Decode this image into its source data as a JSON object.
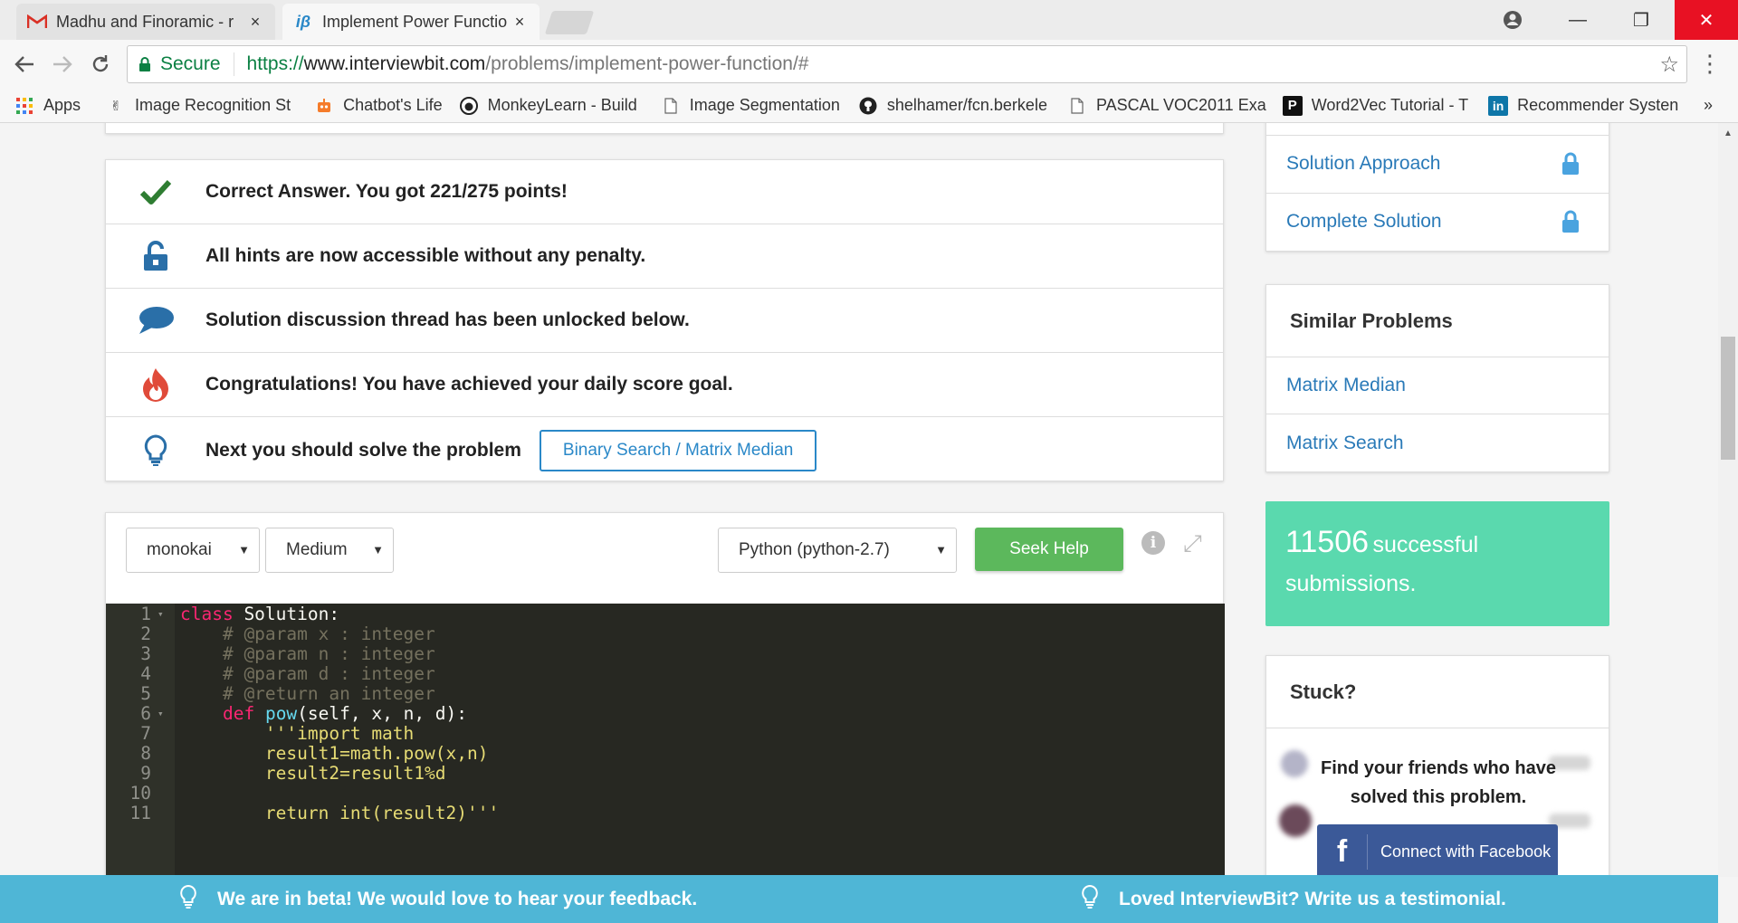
{
  "browser": {
    "tabs": [
      {
        "title": "Madhu and Finoramic - r",
        "favicon": "gmail-icon",
        "active": false
      },
      {
        "title": "Implement Power Functio",
        "favicon": "interviewbit-icon",
        "active": true
      }
    ],
    "close_glyph": "×",
    "window_controls": {
      "minimize": "—",
      "restore": "❐",
      "close": "✕"
    },
    "secure_label": "Secure",
    "url_scheme": "https://",
    "url_host": "www.interviewbit.com",
    "url_path": "/problems/implement-power-function/#",
    "bookmarks": [
      {
        "label": "Apps",
        "icon": "apps-grid-icon"
      },
      {
        "label": "Image Recognition St",
        "icon": "peace-hand-icon"
      },
      {
        "label": "Chatbot's Life",
        "icon": "robot-icon"
      },
      {
        "label": "MonkeyLearn - Build",
        "icon": "monkeylearn-icon"
      },
      {
        "label": "Image Segmentation",
        "icon": "page-icon"
      },
      {
        "label": "shelhamer/fcn.berkele",
        "icon": "github-icon"
      },
      {
        "label": "PASCAL VOC2011 Exa",
        "icon": "page-icon"
      },
      {
        "label": "Word2Vec Tutorial - T",
        "icon": "p-logo-icon"
      },
      {
        "label": "Recommender Systen",
        "icon": "linkedin-icon"
      }
    ],
    "more_bookmarks": "»"
  },
  "results": [
    {
      "icon": "checkmark-icon",
      "text": "Correct Answer. You got 221/275 points!"
    },
    {
      "icon": "unlock-icon",
      "text": "All hints are now accessible without any penalty."
    },
    {
      "icon": "chat-bubble-icon",
      "text": "Solution discussion thread has been unlocked below."
    },
    {
      "icon": "fire-icon",
      "text": "Congratulations! You have achieved your daily score goal."
    },
    {
      "icon": "lightbulb-icon",
      "text": "Next you should solve the problem"
    }
  ],
  "next_problem_button": "Binary Search / Matrix Median",
  "editor": {
    "theme": "monokai",
    "font_size": "Medium",
    "language": "Python (python-2.7)",
    "seek_help": "Seek Help",
    "info_glyph": "i",
    "expand_glyph": "⤢",
    "line_numbers": [
      "1",
      "2",
      "3",
      "4",
      "5",
      "6",
      "7",
      "8",
      "9",
      "10",
      "11"
    ],
    "fold_markers": {
      "1": "▾",
      "6": "▾"
    },
    "lines": [
      [
        {
          "t": "class",
          "c": "kw"
        },
        {
          "t": " Solution:",
          "c": ""
        }
      ],
      [
        {
          "t": "    # @param x : integer",
          "c": "cm"
        }
      ],
      [
        {
          "t": "    # @param n : integer",
          "c": "cm"
        }
      ],
      [
        {
          "t": "    # @param d : integer",
          "c": "cm"
        }
      ],
      [
        {
          "t": "    # @return an integer",
          "c": "cm"
        }
      ],
      [
        {
          "t": "    ",
          "c": ""
        },
        {
          "t": "def",
          "c": "kw"
        },
        {
          "t": " ",
          "c": ""
        },
        {
          "t": "pow",
          "c": "fn"
        },
        {
          "t": "(self, x, n, d):",
          "c": ""
        }
      ],
      [
        {
          "t": "        '''import math",
          "c": "st"
        }
      ],
      [
        {
          "t": "        result1=math.pow(x,n)",
          "c": "st"
        }
      ],
      [
        {
          "t": "        result2=result1%d",
          "c": "st"
        }
      ],
      [
        {
          "t": "",
          "c": ""
        }
      ],
      [
        {
          "t": "        return int(result2)'''",
          "c": "st"
        }
      ]
    ]
  },
  "sidebar": {
    "links": [
      {
        "label": "Solution Approach",
        "locked": true
      },
      {
        "label": "Complete Solution",
        "locked": true
      }
    ],
    "similar_title": "Similar Problems",
    "similar_items": [
      "Matrix Median",
      "Matrix Search"
    ],
    "success_count": "11506",
    "success_text_1": "successful",
    "success_text_2": "submissions.",
    "stuck_title": "Stuck?",
    "friends_text": "Find your friends who have solved this problem.",
    "facebook_glyph": "f",
    "facebook_button": "Connect with Facebook"
  },
  "feedback_bar": {
    "left": "We are in beta! We would love to hear your feedback.",
    "right": "Loved InterviewBit? Write us a testimonial."
  },
  "colors": {
    "accent_blue": "#2a88c8",
    "success_green": "#5ad9ae",
    "seek_help_green": "#5cb85c",
    "feedback_bar": "#4fb6d6",
    "check_green": "#2e7d32",
    "icon_blue": "#2a6fa8",
    "fire_red": "#e04b3a",
    "facebook_blue": "#3b5998",
    "editor_bg": "#272822"
  }
}
